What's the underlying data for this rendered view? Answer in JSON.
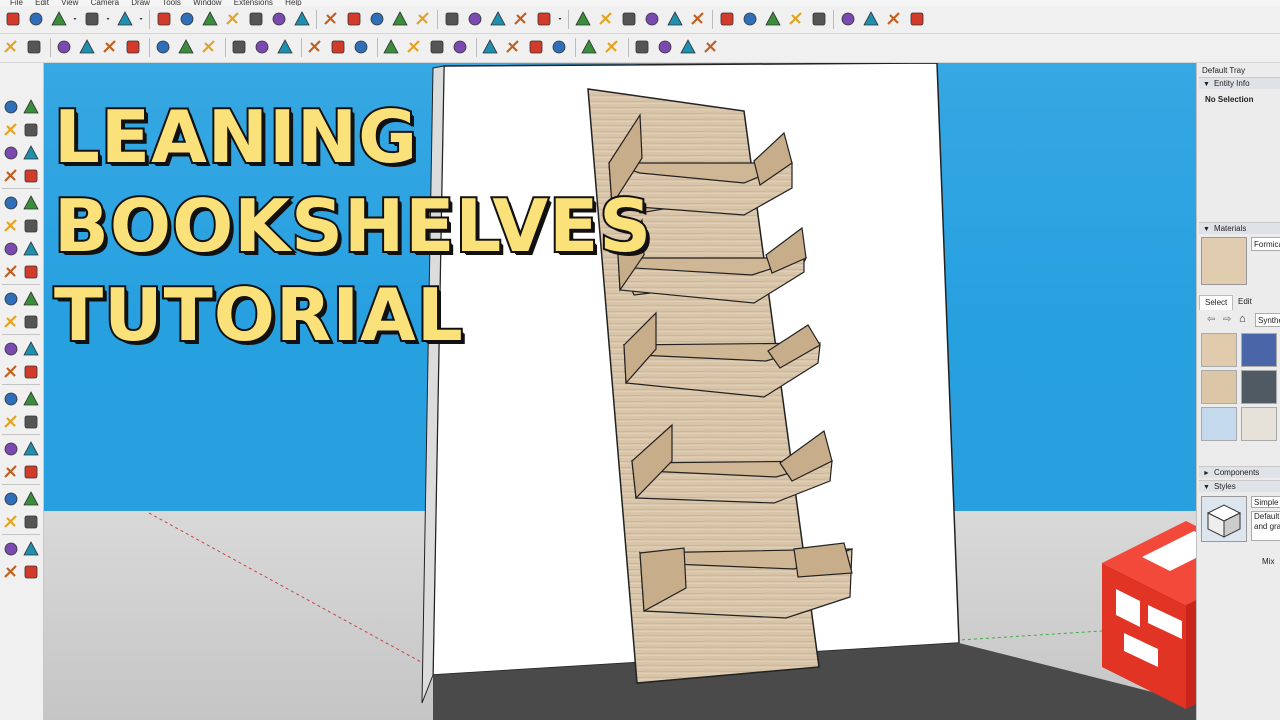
{
  "menu": [
    "File",
    "Edit",
    "View",
    "Camera",
    "Draw",
    "Tools",
    "Window",
    "Extensions",
    "Help"
  ],
  "title_overlay": {
    "line1": "LEANING",
    "line2": "BOOKSHELVES",
    "line3": "TUTORIAL"
  },
  "tray": {
    "title": "Default Tray",
    "entity_info": {
      "header": "Entity Info",
      "status": "No Selection"
    },
    "materials": {
      "header": "Materials",
      "current_name": "Formica",
      "tabs": [
        "Select",
        "Edit"
      ],
      "library": "Synthetic"
    },
    "components": {
      "header": "Components"
    },
    "styles": {
      "header": "Styles",
      "style_name": "Simple S",
      "style_desc_line1": "Default",
      "style_desc_line2": "and gra",
      "mix_tab": "Mix"
    }
  },
  "icons": {
    "toolbar_row1": [
      "select-icon",
      "eraser-icon",
      "line-icon",
      "dropdown-icon",
      "arc-icon",
      "dropdown-icon",
      "rectangle-icon",
      "dropdown-icon",
      "push-pull-icon",
      "follow-me-icon",
      "move-icon",
      "rotate-icon",
      "scale-icon",
      "tape-measure-icon",
      "text-icon",
      "paint-bucket-icon",
      "orbit-icon",
      "pan-icon",
      "zoom-icon",
      "zoom-extents-icon",
      "warehouse-icon",
      "extension-warehouse-icon",
      "layout-icon",
      "send-icon",
      "account-icon",
      "dropdown-icon",
      "iso-view-icon",
      "top-view-icon",
      "front-view-icon",
      "right-view-icon",
      "back-view-icon",
      "left-view-icon",
      "xray-icon",
      "back-edges-icon",
      "wireframe-icon",
      "hidden-line-icon",
      "shaded-icon",
      "section-plane-icon",
      "section-cuts-icon",
      "section-fill-icon",
      "section-display-icon"
    ],
    "toolbar_row2": [
      "color-by-layer-icon",
      "axes-icon",
      "sandbox-from-contours-icon",
      "sandbox-from-scratch-icon",
      "smoove-icon",
      "stamp-icon",
      "drape-icon",
      "add-detail-icon",
      "flip-edge-icon",
      "position-camera-icon",
      "walk-icon",
      "look-around-icon",
      "solid-union-icon",
      "solid-subtract-icon",
      "solid-trim-icon",
      "add-location-icon",
      "geo-terrain-icon",
      "photo-texture-icon",
      "checker-icon",
      "cloud-icon",
      "settings-icon",
      "mail-icon",
      "info-icon",
      "model-info-icon",
      "dimension-icon",
      "protractor-icon",
      "axes-tool-icon",
      "3d-text-icon",
      "section-icon"
    ],
    "left_palette": [
      "select-icon",
      "make-component-icon",
      "paint-bucket-icon",
      "eraser-icon",
      "line-icon",
      "freehand-icon",
      "rectangle-icon",
      "rotated-rectangle-icon",
      "circle-icon",
      "polygon-icon",
      "arc-icon",
      "two-point-arc-icon",
      "three-point-arc-icon",
      "pie-icon",
      "move-icon",
      "push-pull-icon",
      "rotate-icon",
      "follow-me-icon",
      "scale-icon",
      "offset-icon",
      "tape-measure-icon",
      "dimension-icon",
      "protractor-icon",
      "text-icon",
      "axes-icon",
      "3d-text-icon",
      "paint-bucket-icon",
      "orbit-icon",
      "pan-icon",
      "zoom-icon",
      "zoom-window-icon",
      "zoom-extents-icon",
      "previous-view-icon",
      "position-camera-icon",
      "look-around-icon",
      "walk-icon",
      "section-plane-icon",
      "sandbox-icon",
      "sandbox-contours-icon",
      "add-detail-icon"
    ]
  },
  "colors": {
    "sky": "#2aa0e0",
    "ground": "#cfcfcf",
    "title_fill": "#fbe17a",
    "title_stroke": "#111111",
    "logo_red": "#e63323",
    "wood": "#d8c4a8",
    "wood_dark": "#b69a7a"
  }
}
